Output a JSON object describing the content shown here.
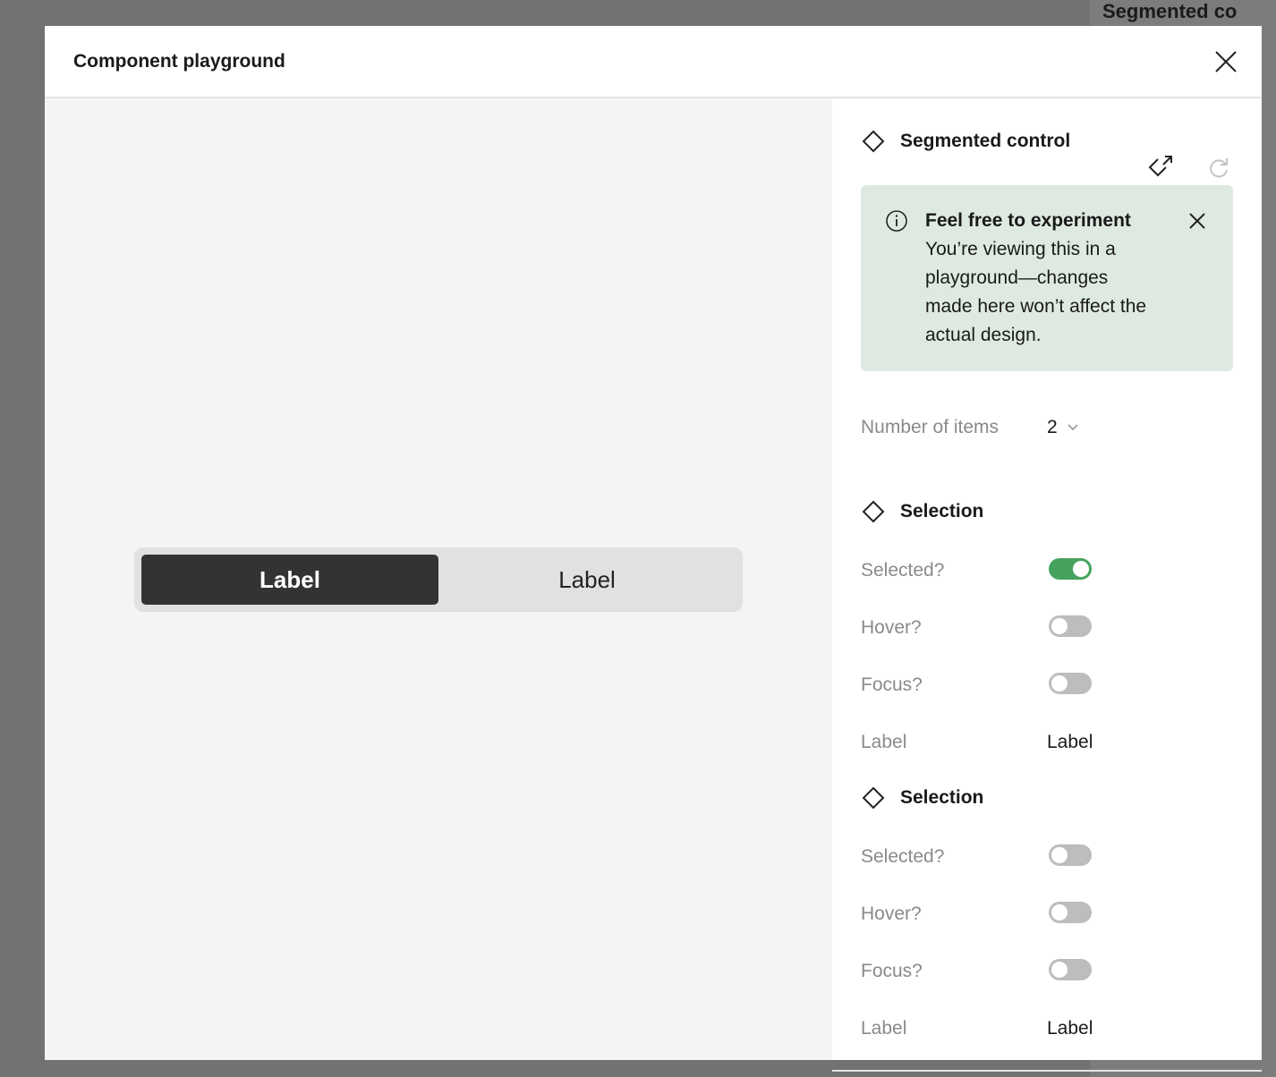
{
  "background": {
    "title_fragment": "Segmented co"
  },
  "modal": {
    "title": "Component playground"
  },
  "preview": {
    "segments": [
      {
        "label": "Label",
        "selected": true
      },
      {
        "label": "Label",
        "selected": false
      }
    ]
  },
  "panel": {
    "component_name": "Segmented control",
    "notice": {
      "title": "Feel free to experiment",
      "body": "You’re viewing this in a playground—changes made here won’t affect the actual design."
    },
    "number_of_items": {
      "label": "Number of items",
      "value": "2"
    },
    "sections": [
      {
        "title": "Selection",
        "selected_label": "Selected?",
        "selected": true,
        "hover_label": "Hover?",
        "hover": false,
        "focus_label": "Focus?",
        "focus": false,
        "label_label": "Label",
        "label_value": "Label"
      },
      {
        "title": "Selection",
        "selected_label": "Selected?",
        "selected": false,
        "hover_label": "Hover?",
        "hover": false,
        "focus_label": "Focus?",
        "focus": false,
        "label_label": "Label",
        "label_value": "Label"
      }
    ]
  },
  "colors": {
    "toggle_on": "#46a35e",
    "notice_bg": "#deeae1",
    "selected_segment": "#333333"
  }
}
